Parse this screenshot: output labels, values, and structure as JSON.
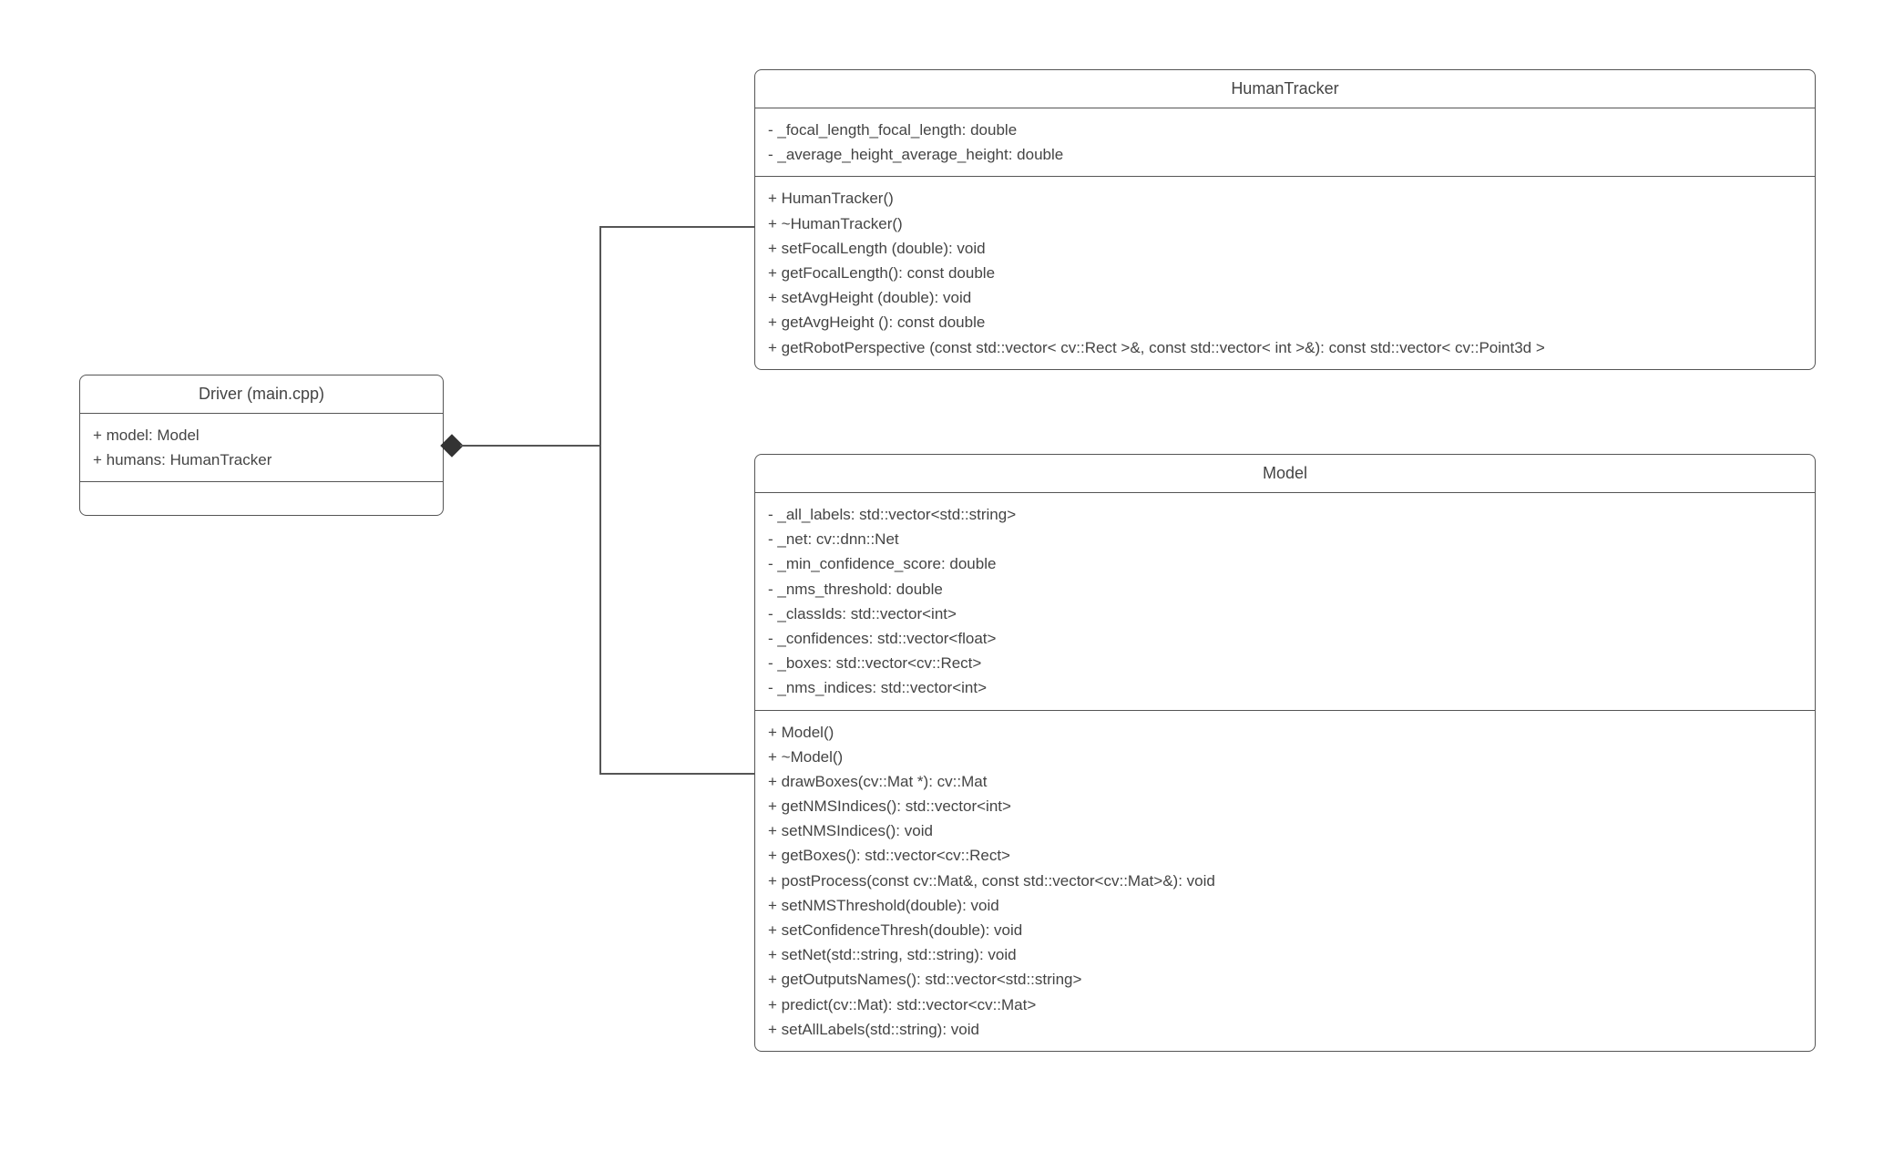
{
  "classes": {
    "driver": {
      "title": "Driver (main.cpp)",
      "attributes": [
        "+ model: Model",
        "+ humans: HumanTracker"
      ],
      "methods": []
    },
    "humanTracker": {
      "title": "HumanTracker",
      "attributes": [
        "- _focal_length_focal_length: double",
        "- _average_height_average_height: double"
      ],
      "methods": [
        "+ HumanTracker()",
        "+ ~HumanTracker()",
        "+ setFocalLength (double): void",
        "+ getFocalLength(): const double",
        "+ setAvgHeight (double): void",
        "+ getAvgHeight (): const double",
        "+ getRobotPerspective (const std::vector< cv::Rect >&, const std::vector< int >&): const std::vector< cv::Point3d >"
      ]
    },
    "model": {
      "title": "Model",
      "attributes": [
        "- _all_labels: std::vector<std::string>",
        "- _net: cv::dnn::Net",
        "- _min_confidence_score: double",
        "- _nms_threshold: double",
        "- _classIds: std::vector<int>",
        "- _confidences: std::vector<float>",
        "- _boxes: std::vector<cv::Rect>",
        "- _nms_indices: std::vector<int>"
      ],
      "methods": [
        "+ Model()",
        "+ ~Model()",
        "+ drawBoxes(cv::Mat *): cv::Mat",
        "+ getNMSIndices(): std::vector<int>",
        "+ setNMSIndices(): void",
        "+ getBoxes(): std::vector<cv::Rect>",
        "+ postProcess(const cv::Mat&, const std::vector<cv::Mat>&): void",
        "+ setNMSThreshold(double): void",
        "+ setConfidenceThresh(double): void",
        "+ setNet(std::string, std::string): void",
        "+ getOutputsNames(): std::vector<std::string>",
        "+ predict(cv::Mat): std::vector<cv::Mat>",
        "+ setAllLabels(std::string): void"
      ]
    }
  },
  "relationships": [
    {
      "from": "driver",
      "to": "humanTracker",
      "type": "composition"
    },
    {
      "from": "driver",
      "to": "model",
      "type": "composition"
    }
  ]
}
